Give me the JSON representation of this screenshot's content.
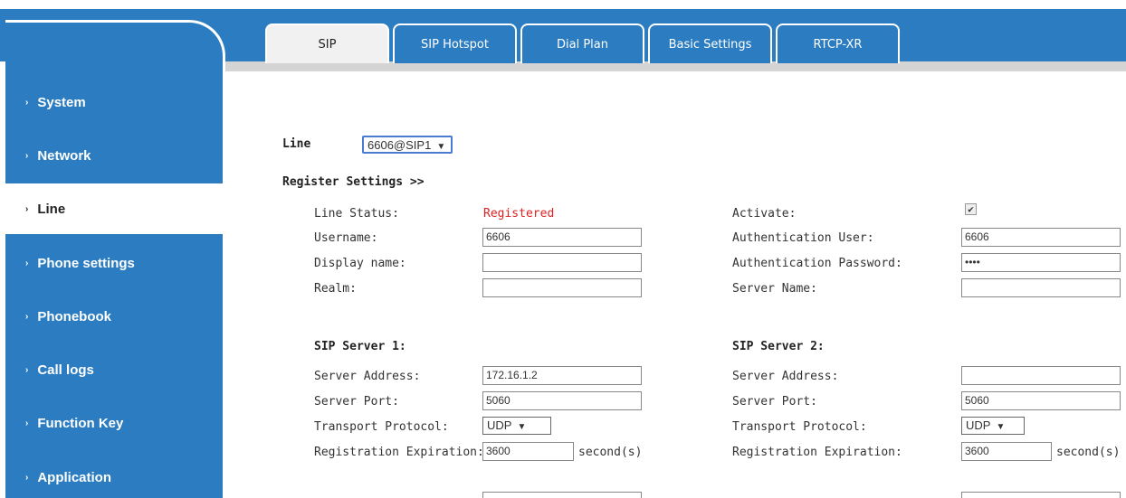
{
  "sidebar": {
    "items": [
      {
        "label": "System"
      },
      {
        "label": "Network"
      },
      {
        "label": "Line"
      },
      {
        "label": "Phone settings"
      },
      {
        "label": "Phonebook"
      },
      {
        "label": "Call logs"
      },
      {
        "label": "Function Key"
      },
      {
        "label": "Application"
      }
    ],
    "active": "Line"
  },
  "tabs": [
    {
      "label": "SIP"
    },
    {
      "label": "SIP Hotspot"
    },
    {
      "label": "Dial Plan"
    },
    {
      "label": "Basic Settings"
    },
    {
      "label": "RTCP-XR"
    }
  ],
  "line": {
    "label": "Line",
    "value": "6606@SIP1"
  },
  "register_settings": {
    "title": "Register Settings >>"
  },
  "fields": {
    "line_status_label": "Line Status:",
    "line_status_value": "Registered",
    "activate_label": "Activate:",
    "activate_checked": "✔",
    "username_label": "Username:",
    "username_value": "6606",
    "auth_user_label": "Authentication User:",
    "auth_user_value": "6606",
    "display_name_label": "Display name:",
    "display_name_value": "",
    "auth_pass_label": "Authentication Password:",
    "auth_pass_value": "••••",
    "realm_label": "Realm:",
    "realm_value": "",
    "server_name_label": "Server Name:",
    "server_name_value": ""
  },
  "sip_server_1": {
    "title": "SIP Server 1:",
    "address_label": "Server Address:",
    "address_value": "172.16.1.2",
    "port_label": "Server Port:",
    "port_value": "5060",
    "transport_label": "Transport Protocol:",
    "transport_value": "UDP",
    "expiration_label": "Registration Expiration:",
    "expiration_value": "3600",
    "expiration_unit": "second(s)"
  },
  "sip_server_2": {
    "title": "SIP Server 2:",
    "address_label": "Server Address:",
    "address_value": "",
    "port_label": "Server Port:",
    "port_value": "5060",
    "transport_label": "Transport Protocol:",
    "transport_value": "UDP",
    "expiration_label": "Registration Expiration:",
    "expiration_value": "3600",
    "expiration_unit": "second(s)"
  },
  "colors": {
    "accent": "#2b7cc0",
    "status": "#d22222"
  }
}
